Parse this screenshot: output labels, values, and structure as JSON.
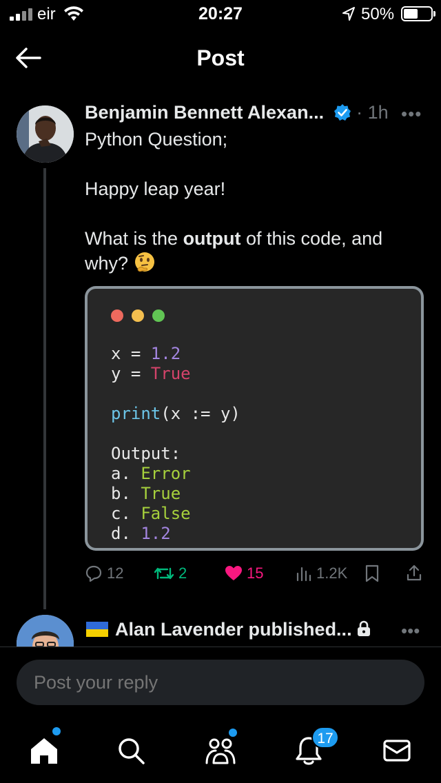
{
  "status_bar": {
    "carrier": "eir",
    "time": "20:27",
    "battery": "50%"
  },
  "header": {
    "title": "Post"
  },
  "post": {
    "author_name": "Benjamin Bennett Alexan...",
    "time_ago": "1h",
    "text_line1": "Python Question;",
    "text_line2": "Happy leap year!",
    "text_q_pre": "What is the ",
    "text_q_bold": "output",
    "text_q_post": " of this code, and",
    "text_q_line2": "why?",
    "code": {
      "line1_var": "x = ",
      "line1_val": "1.2",
      "line2_var": "y = ",
      "line2_val": "True",
      "line3_fn": "print",
      "line3_rest": "(x := y)",
      "output_label": "Output:",
      "opt_a_label": "a. ",
      "opt_a": "Error",
      "opt_b_label": "b. ",
      "opt_b": "True",
      "opt_c_label": "c. ",
      "opt_c": "False",
      "opt_d_label": "d. ",
      "opt_d": "1.2"
    },
    "stats": {
      "replies": "12",
      "reposts": "2",
      "likes": "15",
      "views": "1.2K"
    }
  },
  "next_post": {
    "author_name": "Alan Lavender published..."
  },
  "reply_box": {
    "placeholder": "Post your reply"
  },
  "nav": {
    "notifications_count": "17"
  },
  "colors": {
    "accent": "#1d9bf0",
    "like": "#f91880",
    "repost": "#00ba7c"
  }
}
